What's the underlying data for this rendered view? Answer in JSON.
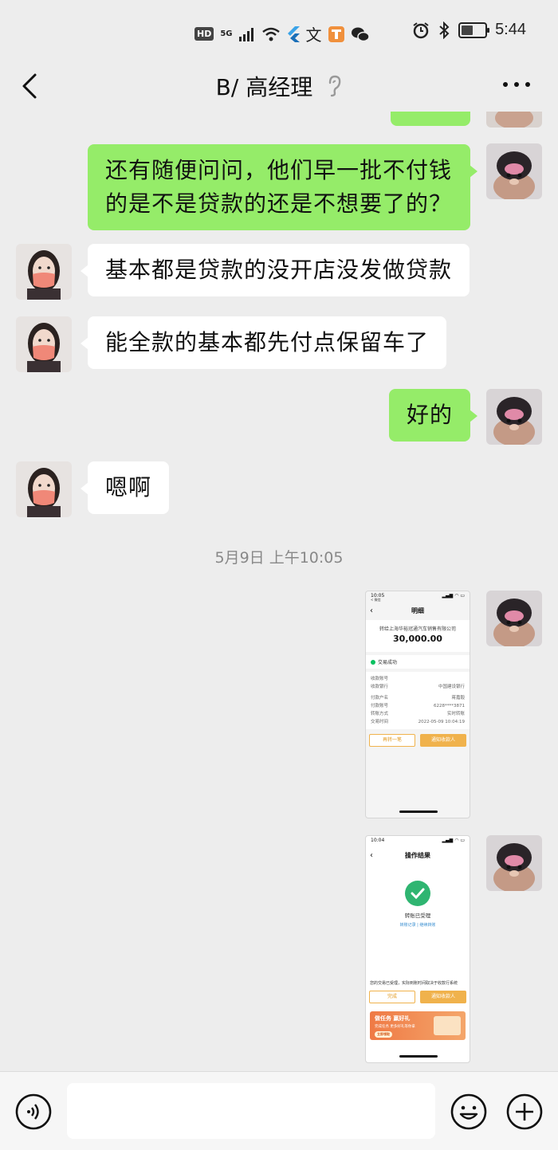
{
  "status_bar": {
    "hd": "HD",
    "network": "5G",
    "time": "5:44",
    "icons": [
      "signal-icon",
      "wifi-icon",
      "flutter-icon",
      "translate-icon",
      "app-icon",
      "wechat-icon",
      "alarm-icon",
      "bluetooth-icon",
      "battery-icon"
    ]
  },
  "header": {
    "title": "B/ 高经理",
    "icons": [
      "back-icon",
      "ear-icon",
      "more-icon"
    ]
  },
  "messages": [
    {
      "from": "me",
      "text": "还有随便问问，他们早一批不付钱"
    },
    {
      "from": "me",
      "text": "的是不是贷款的还是不想要了的？"
    },
    {
      "from": "them",
      "text": "基本都是贷款的没开店没发做贷款"
    },
    {
      "from": "them",
      "text": "能全款的基本都先付点保留车了"
    },
    {
      "from": "me",
      "text": "好的"
    },
    {
      "from": "them",
      "text": "嗯啊"
    }
  ],
  "timestamp": "5月9日 上午10:05",
  "image1": {
    "time": "10:05",
    "back_label": "< 微信",
    "title": "明细",
    "payee": "转给上海华裕冠通汽车销售有限公司",
    "amount": "30,000.00",
    "status": "交易成功",
    "rows": [
      {
        "label": "收款账号",
        "value": ""
      },
      {
        "label": "收款银行",
        "value": "中国建设银行"
      },
      {
        "label": "付款户名",
        "value": "蒋嘉毅"
      },
      {
        "label": "付款账号",
        "value": "6228****3871"
      },
      {
        "label": "转账方式",
        "value": "实时转账"
      },
      {
        "label": "交易时间",
        "value": "2022-05-09 10:04:19"
      }
    ],
    "btn_again": "再转一笔",
    "btn_notify": "通知收款人"
  },
  "image2": {
    "time": "10:04",
    "title": "操作结果",
    "result": "转账已受理",
    "links": "转账记录 | 继续转账",
    "note": "您的交易已受理，实际到账时间取决于收款行系统",
    "btn_done": "完成",
    "btn_notify": "通知收款人",
    "banner_title": "做任务 赢好礼",
    "banner_sub": "完成任务 更多好礼等你拿",
    "banner_go": "立即领取"
  },
  "input_bar": {
    "placeholder": "",
    "icons": [
      "voice-icon",
      "emoji-icon",
      "plus-icon"
    ]
  },
  "colors": {
    "background": "#ededed",
    "my_bubble": "#95ec69",
    "their_bubble": "#ffffff",
    "timestamp": "#888888"
  }
}
